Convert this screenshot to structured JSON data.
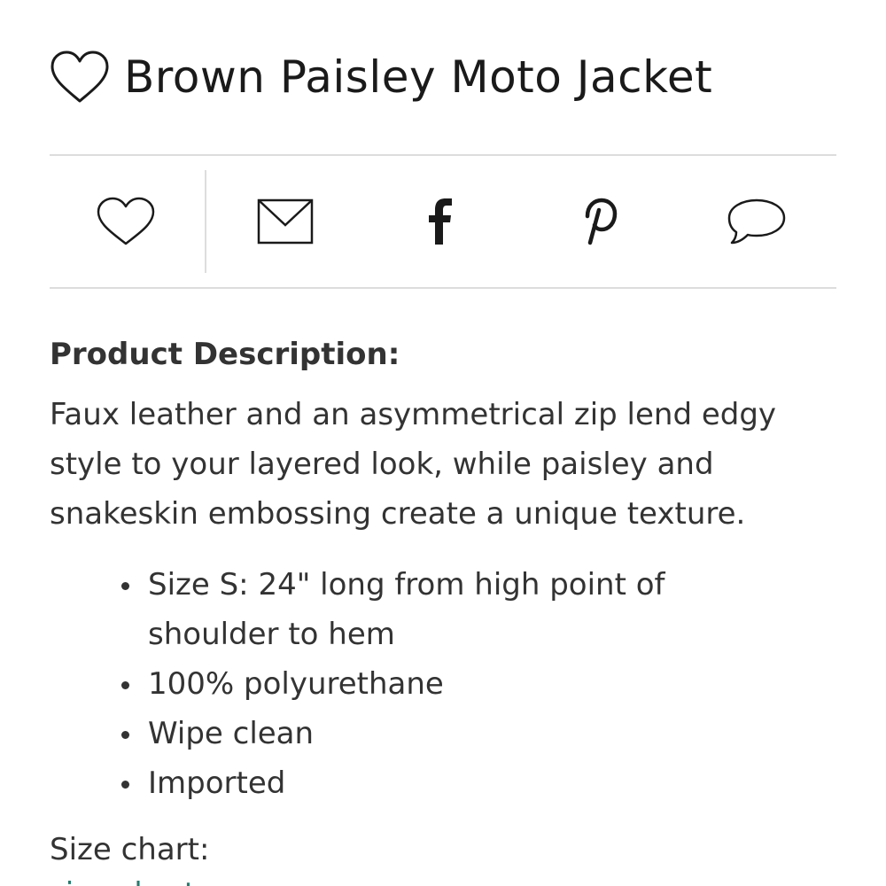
{
  "product": {
    "title": "Brown Paisley Moto Jacket",
    "title_icon": "heart-outline-icon"
  },
  "share_bar": {
    "items": [
      {
        "name": "favorite",
        "icon": "heart-outline-icon"
      },
      {
        "name": "email",
        "icon": "envelope-icon"
      },
      {
        "name": "facebook",
        "icon": "facebook-icon"
      },
      {
        "name": "pinterest",
        "icon": "pinterest-icon"
      },
      {
        "name": "comment",
        "icon": "speech-bubble-icon"
      }
    ]
  },
  "description": {
    "heading": "Product Description:",
    "text": "Faux leather and an asymmetrical zip lend edgy style to your layered look, while paisley and snakeskin embossing create a unique texture.",
    "bullets": [
      "Size S: 24\" long from high point of shoulder to hem",
      "100% polyurethane",
      "Wipe clean",
      "Imported"
    ]
  },
  "size_chart": {
    "label": "Size chart:",
    "link_text": "size chart"
  },
  "colors": {
    "text": "#333333",
    "divider": "#dddddd",
    "link": "#2a7a6f"
  }
}
